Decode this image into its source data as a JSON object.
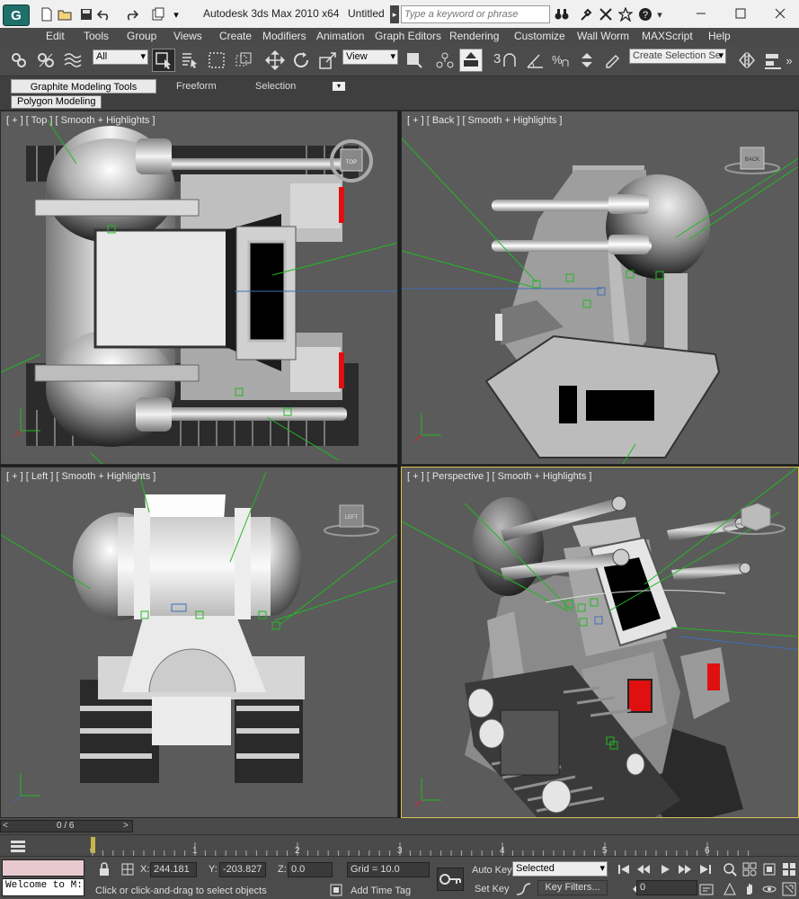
{
  "app": {
    "title": "Autodesk 3ds Max  2010 x64",
    "document": "Untitled",
    "search_placeholder": "Type a keyword or phrase",
    "logo_letter": "G"
  },
  "menu": [
    "Edit",
    "Tools",
    "Group",
    "Views",
    "Create",
    "Modifiers",
    "Animation",
    "Graph Editors",
    "Rendering",
    "Customize",
    "Wall Worm",
    "MAXScript",
    "Help"
  ],
  "toolbar": {
    "selection_filter": "All",
    "ref_coord": "View",
    "snap_label": "3",
    "named_selection": "Create Selection Se"
  },
  "ribbon": {
    "tabs": [
      "Graphite Modeling Tools",
      "Freeform",
      "Selection"
    ],
    "panel": "Polygon Modeling"
  },
  "viewports": {
    "top": {
      "label": "[ + ] [ Top ] [ Smooth + Highlights ]",
      "cube": "TOP"
    },
    "back": {
      "label": "[ + ] [ Back ] [ Smooth + Highlights ]",
      "cube": "BACK"
    },
    "left": {
      "label": "[ + ] [ Left ] [ Smooth + Highlights ]",
      "cube": "LEFT"
    },
    "persp": {
      "label": "[ + ] [ Perspective ] [ Smooth + Highlights ]"
    }
  },
  "timeline": {
    "frame": "0 / 6",
    "ticks": [
      "0",
      "1",
      "2",
      "3",
      "4",
      "5",
      "6"
    ]
  },
  "status": {
    "welcome": "Welcome to M:",
    "prompt": "Click or click-and-drag to select objects",
    "x_label": "X:",
    "x": "244.181",
    "y_label": "Y:",
    "y": "-203.827",
    "z_label": "Z:",
    "z": "0.0",
    "grid": "Grid = 10.0",
    "add_time_tag": "Add Time Tag",
    "auto_key": "Auto Key",
    "set_key": "Set Key",
    "key_mode": "Selected",
    "key_filters": "Key Filters...",
    "current_frame": "0"
  },
  "colors": {
    "accent": "#d9c25a",
    "viewport_bg": "#5b5b5b",
    "red": "#e01010",
    "helper_green": "#22b822"
  }
}
